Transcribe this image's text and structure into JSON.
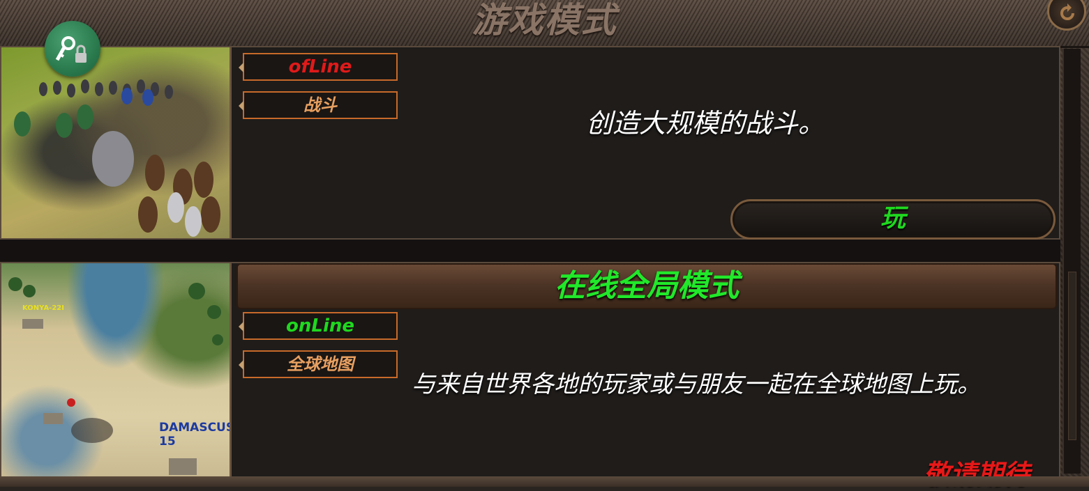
{
  "header": {
    "title": "游戏模式",
    "back_icon": "refresh-back-icon"
  },
  "lock_button": {
    "icon": "key-lock-icon",
    "color": "#2a7a4e"
  },
  "modes": [
    {
      "status_tag": "ofLine",
      "status_color": "#e01a1a",
      "type_tag": "战斗",
      "type_color": "#e8a060",
      "description": "创造大规模的战斗。",
      "play_label": "玩",
      "play_color": "#1fd81f"
    },
    {
      "banner": "在线全局模式",
      "status_tag": "onLine",
      "status_color": "#1fd81f",
      "type_tag": "全球地图",
      "type_color": "#e8a060",
      "description": "与来自世界各地的玩家或与朋友一起在全球地图上玩。",
      "coming_soon": "敬请期待",
      "map_labels": [
        "KONYA-22I",
        "DAMASCUS-15"
      ]
    }
  ]
}
